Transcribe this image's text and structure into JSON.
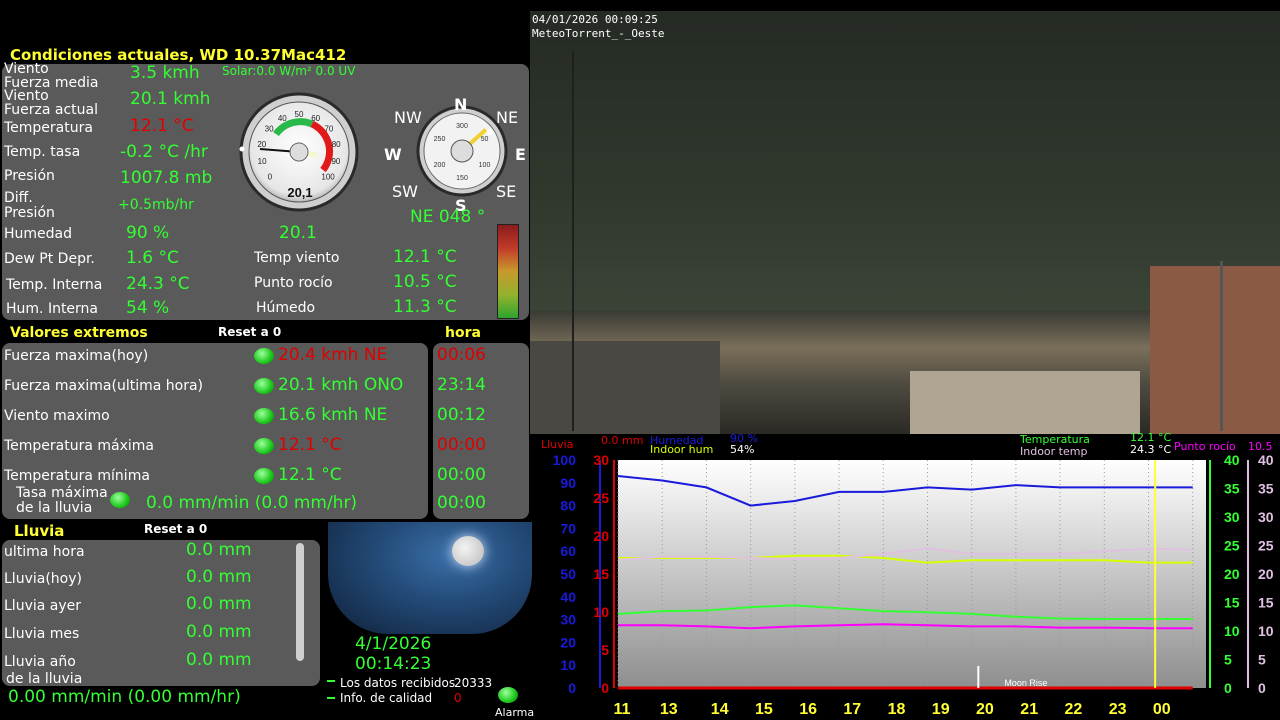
{
  "header": {
    "title": "Condiciones actuales, WD 10.37Mac412",
    "solar": "Solar:0.0 W/m² 0.0 UV"
  },
  "current": {
    "viento_label": "Viento",
    "viento_value": "3.5 kmh",
    "fuerza_media_label": "Fuerza media",
    "viento2_label": "Viento",
    "fuerza_actual_label": "Fuerza actual",
    "fuerza_value": "20.1 kmh",
    "temperatura_label": "Temperatura",
    "temperatura_value": "12.1 °C",
    "temp_tasa_label": "Temp. tasa",
    "temp_tasa_value": "-0.2 °C /hr",
    "presion_label": "Presión",
    "presion_value": "1007.8 mb",
    "diff_label": "Diff.",
    "diff_presion_label": "Presión",
    "diff_value": "+0.5mb/hr",
    "humedad_label": "Humedad",
    "humedad_value": "90 %",
    "dew_label": "Dew Pt Depr.",
    "dew_value": "1.6 °C",
    "temp_interna_label": "Temp. Interna",
    "temp_interna_value": "24.3 °C",
    "hum_interna_label": "Hum. Interna",
    "hum_interna_value": "54 %",
    "temp_viento_label": "Temp viento",
    "temp_viento_value": "12.1 °C",
    "punto_rocio_label": "Punto rocío",
    "punto_rocio_value": "10.5 °C",
    "humedo_label": "Húmedo",
    "humedo_value": "11.3 °C",
    "gauge_speed_readout": "20,1",
    "gust_below_gauge": "20.1",
    "wind_dir_text": "NE  048 °"
  },
  "speed_gauge": {
    "ticks": [
      "0",
      "10",
      "20",
      "30",
      "40",
      "50",
      "60",
      "70",
      "80",
      "90",
      "100"
    ]
  },
  "compass": {
    "n": "N",
    "ne": "NE",
    "e": "E",
    "se": "SE",
    "s": "S",
    "sw": "SW",
    "w": "W",
    "nw": "NW",
    "inner_ticks": [
      "300",
      "50",
      "100",
      "150",
      "200",
      "250"
    ],
    "direction_deg": 48
  },
  "extremes": {
    "title": "Valores extremos",
    "reset": "Reset a 0",
    "hora_title": "hora",
    "rows": [
      {
        "label": "Fuerza maxima(hoy)",
        "value": "20.4 kmh  NE",
        "time": "00:06",
        "red": true
      },
      {
        "label": "Fuerza maxima(ultima hora)",
        "value": "20.1 kmh ONO",
        "time": "23:14",
        "red": false
      },
      {
        "label": "Viento maximo",
        "value": "16.6 kmh  NE",
        "time": "00:12",
        "red": false
      },
      {
        "label": "Temperatura máxima",
        "value": "12.1 °C",
        "time": "00:00",
        "red": true
      },
      {
        "label": "Temperatura mínima",
        "value": "12.1 °C",
        "time": "00:00",
        "red": false
      }
    ],
    "tasa_label1": "Tasa máxima",
    "tasa_label2": "de la lluvia",
    "tasa_value": "0.0 mm/min (0.0 mm/hr)",
    "tasa_time": "00:00"
  },
  "rain": {
    "title": "Lluvia",
    "reset": "Reset a 0",
    "rows": [
      {
        "label": "ultima hora",
        "value": "0.0 mm"
      },
      {
        "label": "Lluvia(hoy)",
        "value": "0.0 mm"
      },
      {
        "label": "Lluvia ayer",
        "value": "0.0 mm"
      },
      {
        "label": "Lluvia mes",
        "value": "0.0 mm"
      },
      {
        "label": "Lluvia año",
        "value": "0.0 mm"
      }
    ],
    "rate_label": "de la lluvia",
    "rate_value": "0.00 mm/min (0.00 mm/hr)"
  },
  "moon": {
    "date": "4/1/2026",
    "time": "00:14:23"
  },
  "status": {
    "received_label": "Los datos recibidos",
    "received_value": "20333",
    "quality_label": "Info. de calidad",
    "quality_value": "0",
    "alarm_label": "Alarma"
  },
  "camera": {
    "timestamp": "04/01/2026 00:09:25",
    "name": "MeteoTorrent_-_Oeste"
  },
  "graph_legend": {
    "lluvia_label": "Lluvia",
    "lluvia_value": "0.0 mm",
    "humedad_label": "Humedad",
    "humedad_value": "90 %",
    "indoor_hum_label": "Indoor hum",
    "indoor_hum_value": "54%",
    "temperatura_label": "Temperatura",
    "temperatura_value": "12.1 °C",
    "indoor_temp_label": "Indoor temp",
    "indoor_temp_value": "24.3 °C",
    "punto_rocio_label": "Punto rocío",
    "punto_rocio_value": "10.5",
    "moonrise_label": "Moon Rise"
  },
  "chart_data": {
    "type": "line",
    "x_ticks": [
      "11",
      "13",
      "14",
      "15",
      "16",
      "17",
      "18",
      "19",
      "20",
      "21",
      "22",
      "23",
      "00"
    ],
    "x_values": [
      11,
      12,
      13,
      14,
      15,
      16,
      17,
      18,
      19,
      20,
      21,
      22,
      23,
      24
    ],
    "xlim": [
      11,
      24.3
    ],
    "axis_left_humidity": [
      0,
      10,
      20,
      30,
      40,
      50,
      60,
      70,
      80,
      90,
      100
    ],
    "axis_left_rain": [
      0,
      5,
      10,
      15,
      20,
      25,
      30
    ],
    "axis_right_temp": [
      0,
      5,
      10,
      15,
      20,
      25,
      30,
      35,
      40
    ],
    "cursor_x": 23.15,
    "moonrise_x": 19.15,
    "series": [
      {
        "name": "Humedad",
        "axis": "humidity",
        "color": "#1a1adb",
        "values": [
          93,
          91,
          88,
          80,
          82,
          86,
          86,
          88,
          87,
          89,
          88,
          88,
          88,
          88
        ]
      },
      {
        "name": "Indoor hum",
        "axis": "humidity",
        "color": "#d6ff00",
        "values": [
          57,
          57,
          57,
          57,
          58,
          58,
          57,
          55,
          56,
          56,
          56,
          56,
          55,
          55
        ]
      },
      {
        "name": "Indoor temp",
        "axis": "temp",
        "color": "#e0c0e0",
        "values": [
          22.5,
          23.0,
          23.0,
          22.8,
          22.6,
          22.8,
          23.5,
          24.5,
          23.5,
          23.5,
          23.5,
          24.0,
          24.4,
          24.3
        ]
      },
      {
        "name": "Temperatura",
        "axis": "temp",
        "color": "#33ff33",
        "values": [
          13.0,
          13.5,
          13.6,
          14.2,
          14.5,
          14.0,
          13.5,
          13.3,
          13.0,
          12.5,
          12.2,
          12.1,
          12.1,
          12.1
        ]
      },
      {
        "name": "Punto rocío",
        "axis": "temp",
        "color": "#ff00ff",
        "values": [
          11.0,
          11.0,
          10.8,
          10.5,
          10.8,
          11.0,
          11.2,
          11.0,
          10.8,
          10.8,
          10.6,
          10.6,
          10.5,
          10.5
        ]
      },
      {
        "name": "Lluvia",
        "axis": "rain",
        "color": "#e00000",
        "values": [
          0,
          0,
          0,
          0,
          0,
          0,
          0,
          0,
          0,
          0,
          0,
          0,
          0,
          0
        ]
      }
    ]
  },
  "colors": {
    "panel": "#5a5a5a",
    "green": "#33ff33",
    "red": "#e00000",
    "yellow": "#ffff33"
  }
}
